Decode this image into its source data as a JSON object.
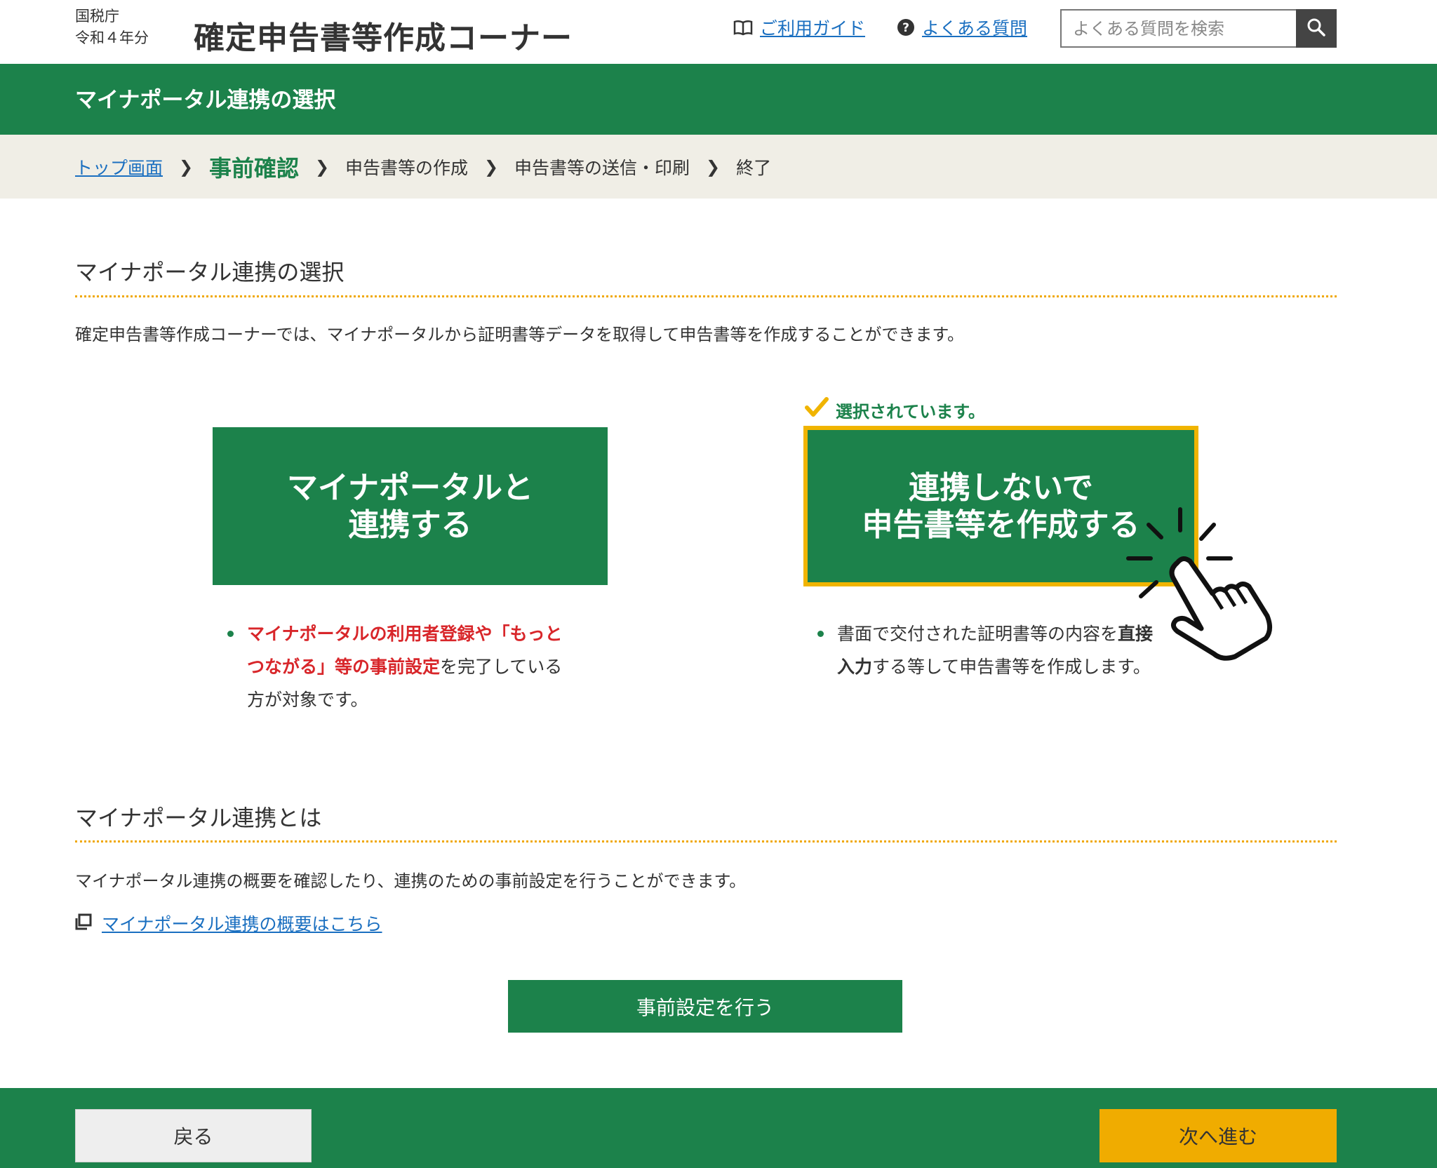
{
  "header": {
    "agency": "国税庁",
    "year": "令和４年分",
    "title": "確定申告書等作成コーナー",
    "guide_link": "ご利用ガイド",
    "faq_link": "よくある質問",
    "search_placeholder": "よくある質問を検索"
  },
  "titlebar": {
    "title": "マイナポータル連携の選択"
  },
  "breadcrumb": [
    {
      "label": "トップ画面"
    },
    {
      "label": "事前確認"
    },
    {
      "label": "申告書等の作成"
    },
    {
      "label": "申告書等の送信・印刷"
    },
    {
      "label": "終了"
    }
  ],
  "section1": {
    "title": "マイナポータル連携の選択",
    "description": "確定申告書等作成コーナーでは、マイナポータルから証明書等データを取得して申告書等を作成することができます。"
  },
  "options": {
    "selected_note": "選択されています。",
    "link": {
      "line1": "マイナポータルと",
      "line2": "連携する",
      "note_red": "マイナポータルの利用者登録や「もっとつながる」等の事前設定",
      "note_rest": "を完了している方が対象です。"
    },
    "nolink": {
      "line1": "連携しないで",
      "line2": "申告書等を作成する",
      "note_a": "書面で交付された証明書等の内容を",
      "note_bold": "直接入力",
      "note_b": "する等して申告書等を作成します。"
    }
  },
  "section2": {
    "title": "マイナポータル連携とは",
    "description": "マイナポータル連携の概要を確認したり、連携のための事前設定を行うことができます。",
    "ext_link": "マイナポータル連携の概要はこちら",
    "presetting_button": "事前設定を行う"
  },
  "footer": {
    "back": "戻る",
    "next": "次へ進む"
  },
  "colors": {
    "green": "#1c824b",
    "yellow": "#f0ac00",
    "link": "#1a6fc0",
    "red": "#d8262a"
  }
}
